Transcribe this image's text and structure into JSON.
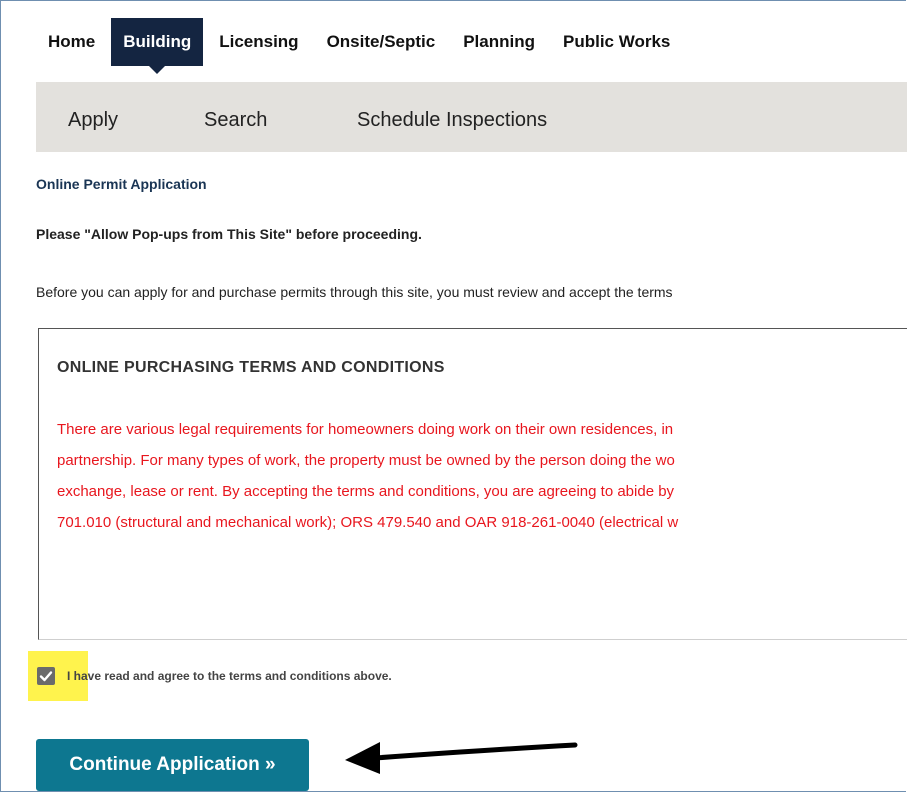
{
  "topnav": {
    "items": [
      {
        "label": "Home"
      },
      {
        "label": "Building"
      },
      {
        "label": "Licensing"
      },
      {
        "label": "Onsite/Septic"
      },
      {
        "label": "Planning"
      },
      {
        "label": "Public Works"
      }
    ],
    "active": "Building"
  },
  "subnav": {
    "items": [
      {
        "label": "Apply"
      },
      {
        "label": "Search"
      },
      {
        "label": "Schedule Inspections"
      }
    ]
  },
  "page": {
    "section_title": "Online Permit Application",
    "popup_note": "Please \"Allow Pop-ups from This Site\" before proceeding.",
    "intro": "Before you can apply for and purchase permits through this site, you must review and accept the terms"
  },
  "terms": {
    "title": "ONLINE PURCHASING TERMS AND CONDITIONS",
    "lines": [
      "There are various legal requirements for homeowners doing work on their own residences, in",
      "partnership. For many types of work, the property must be owned by the person doing the wo",
      "exchange, lease or rent. By accepting the terms and conditions, you are agreeing to abide by",
      "701.010 (structural and mechanical work); ORS 479.540 and OAR 918-261-0040 (electrical w"
    ]
  },
  "agreement": {
    "checked": true,
    "label": "I have read and agree to the terms and conditions above."
  },
  "actions": {
    "continue_label": "Continue Application »"
  },
  "colors": {
    "active_nav": "#142541",
    "subnav_bg": "#e3e1dd",
    "terms_text": "#e8161e",
    "button": "#0d7790",
    "highlight": "#fff34d"
  },
  "icons": {
    "checkbox": "checkmark-icon",
    "annotation": "arrow-left-icon"
  }
}
